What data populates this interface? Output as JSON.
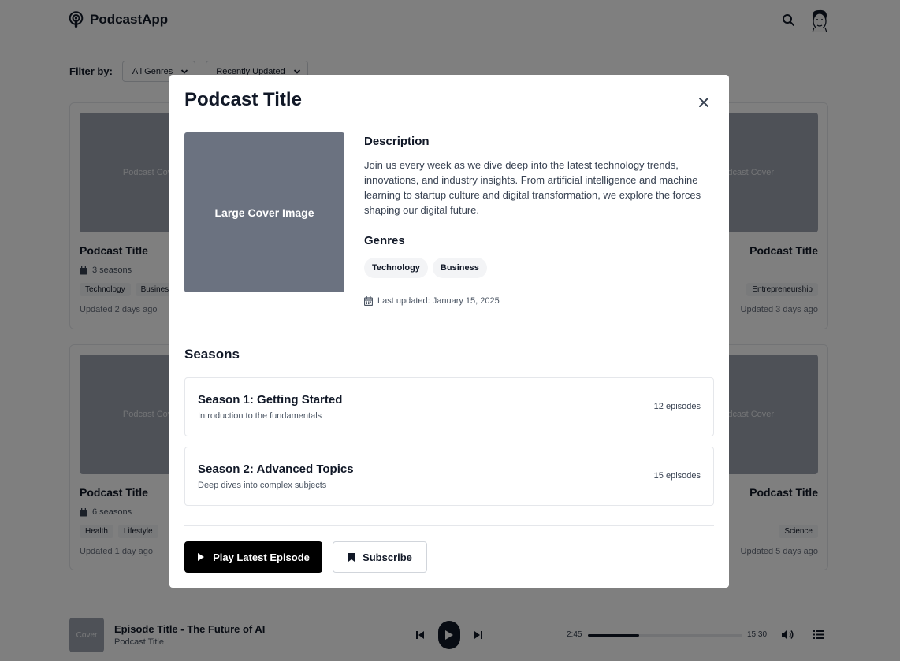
{
  "header": {
    "app_name": "PodcastApp",
    "icons": {
      "logo": "podcast-icon",
      "search": "search-icon",
      "avatar": "avatar"
    }
  },
  "filter": {
    "label": "Filter by:",
    "genre_select": "All Genres",
    "sort_select": "Recently Updated"
  },
  "cards": [
    {
      "cover": "Podcast Cover",
      "title": "Podcast Title",
      "seasons": "3 seasons",
      "tags": [
        "Technology",
        "Business"
      ],
      "updated": "Updated 2 days ago"
    },
    {
      "cover": "Podcast Cover",
      "title": "Podcast Title",
      "seasons": "",
      "tags": [
        "Entrepreneurship"
      ],
      "updated": "Updated 3 days ago"
    },
    {
      "cover": "Podcast Cover",
      "title": "Podcast Title",
      "seasons": "6 seasons",
      "tags": [
        "Health",
        "Lifestyle"
      ],
      "updated": "Updated 1 day ago"
    },
    {
      "cover": "Podcast Cover",
      "title": "Podcast Title",
      "seasons": "",
      "tags": [
        "Science"
      ],
      "updated": "Updated 5 days ago"
    }
  ],
  "player": {
    "cover": "Cover",
    "episode_title": "Episode Title - The Future of AI",
    "podcast_title": "Podcast Title",
    "current_time": "2:45",
    "duration": "15:30",
    "progress": 0.33
  },
  "modal": {
    "title": "Podcast Title",
    "cover_label": "Large Cover Image",
    "description_heading": "Description",
    "description": "Join us every week as we dive deep into the latest technology trends, innovations, and industry insights. From artificial intelligence and machine learning to startup culture and digital transformation, we explore the forces shaping our digital future.",
    "genres_heading": "Genres",
    "genres": [
      "Technology",
      "Business"
    ],
    "last_updated": "Last updated: January 15, 2025",
    "seasons_heading": "Seasons",
    "seasons": [
      {
        "title": "Season 1: Getting Started",
        "subtitle": "Introduction to the fundamentals",
        "episodes": "12 episodes"
      },
      {
        "title": "Season 2: Advanced Topics",
        "subtitle": "Deep dives into complex subjects",
        "episodes": "15 episodes"
      }
    ],
    "play_button": "Play Latest Episode",
    "subscribe_button": "Subscribe"
  }
}
